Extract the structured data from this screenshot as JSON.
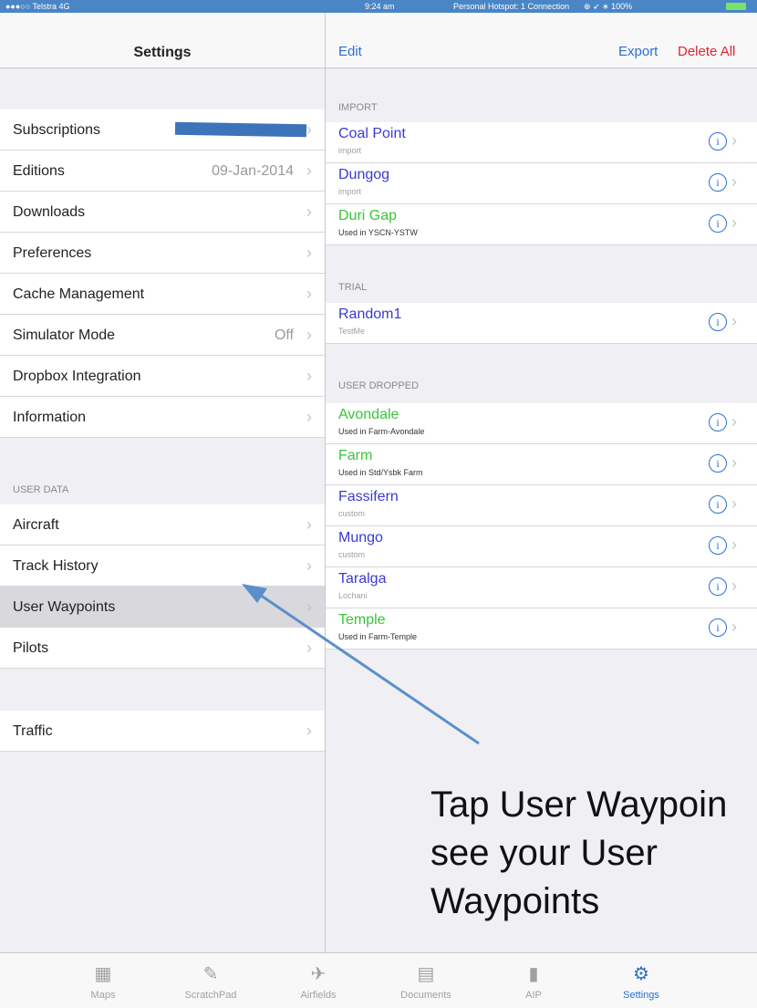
{
  "status_bar": {
    "carrier": "●●●○○ Telstra  4G",
    "time": "9:24 am",
    "hotspot": "Personal Hotspot: 1 Connection",
    "right": "⊕ ➶ ∗ 100%"
  },
  "left": {
    "title": "Settings",
    "rows": [
      {
        "label": "Subscriptions",
        "value": "",
        "selected": false
      },
      {
        "label": "Editions",
        "value": "09-Jan-2014",
        "selected": false
      },
      {
        "label": "Downloads",
        "value": "",
        "selected": false
      },
      {
        "label": "Preferences",
        "value": "",
        "selected": false
      },
      {
        "label": "Cache Management",
        "value": "",
        "selected": false
      },
      {
        "label": "Simulator Mode",
        "value": "Off",
        "selected": false
      },
      {
        "label": "Dropbox Integration",
        "value": "",
        "selected": false
      },
      {
        "label": "Information",
        "value": "",
        "selected": false
      }
    ],
    "user_data_header": "USER DATA",
    "user_rows": [
      {
        "label": "Aircraft",
        "selected": false
      },
      {
        "label": "Track History",
        "selected": false
      },
      {
        "label": "User Waypoints",
        "selected": true
      },
      {
        "label": "Pilots",
        "selected": false
      }
    ],
    "extra_rows": [
      {
        "label": "Traffic"
      }
    ]
  },
  "right": {
    "edit": "Edit",
    "export": "Export",
    "delete_all": "Delete All",
    "sections": [
      {
        "header": "IMPORT",
        "items": [
          {
            "name": "Coal Point",
            "sub": "import",
            "color": "#3a3ad4"
          },
          {
            "name": "Dungog",
            "sub": "import",
            "color": "#3a3ad4"
          },
          {
            "name": "Duri Gap",
            "sub": "Used in YSCN-YSTW",
            "color": "#3ac43a"
          }
        ]
      },
      {
        "header": "TRIAL",
        "items": [
          {
            "name": "Random1",
            "sub": "TestMe",
            "color": "#3a3ad4"
          }
        ]
      },
      {
        "header": "USER DROPPED",
        "items": [
          {
            "name": "Avondale",
            "sub": "Used in Farm-Avondale",
            "color": "#3ac43a"
          },
          {
            "name": "Farm",
            "sub": "Used in Std/Ysbk Farm",
            "color": "#3ac43a"
          },
          {
            "name": "Fassifern",
            "sub": "custom",
            "color": "#3a3ad4"
          },
          {
            "name": "Mungo",
            "sub": "custom",
            "color": "#3a3ad4"
          },
          {
            "name": "Taralga",
            "sub": "Lochani",
            "color": "#3a3ad4"
          },
          {
            "name": "Temple",
            "sub": "Used in Farm-Temple",
            "color": "#3ac43a"
          }
        ]
      }
    ]
  },
  "annotation": {
    "line1": "Tap User Waypoin",
    "line2": "see your User",
    "line3": "Waypoints"
  },
  "tabs": [
    {
      "label": "Maps",
      "icon": "map-icon",
      "active": false
    },
    {
      "label": "ScratchPad",
      "icon": "palette-icon",
      "active": false
    },
    {
      "label": "Airfields",
      "icon": "airplane-icon",
      "active": false
    },
    {
      "label": "Documents",
      "icon": "documents-icon",
      "active": false
    },
    {
      "label": "AIP",
      "icon": "book-icon",
      "active": false
    },
    {
      "label": "Settings",
      "icon": "gear-icon",
      "active": true
    }
  ],
  "colors": {
    "accent": "#2a6fd6",
    "destructive": "#e0242e",
    "import_name": "#3a3ad4",
    "used_name": "#3ac43a"
  }
}
